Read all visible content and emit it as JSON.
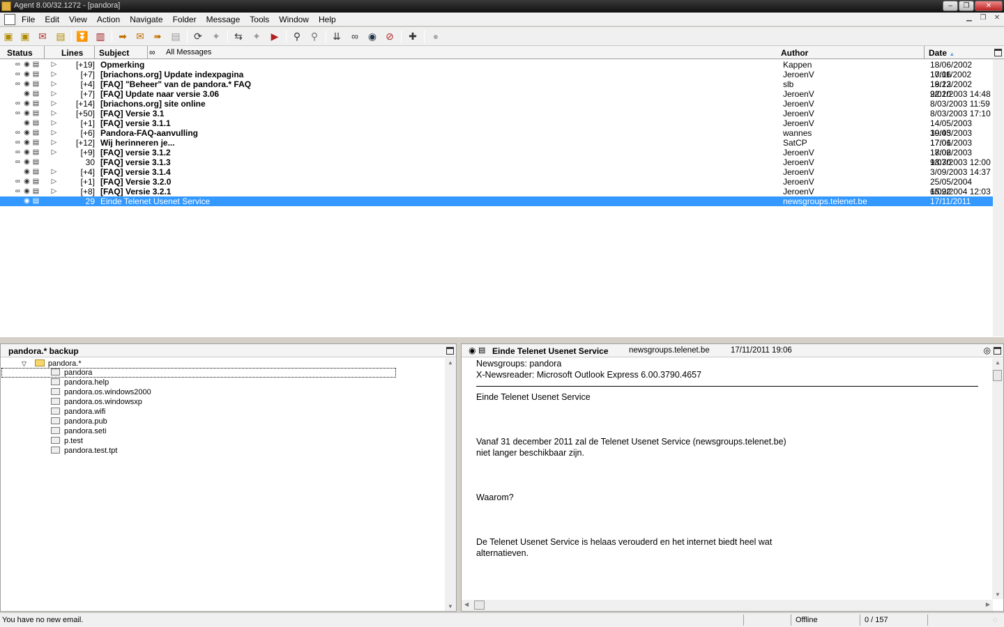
{
  "window": {
    "title": "Agent 8.00/32.1272 - [pandora]"
  },
  "menu": [
    "File",
    "Edit",
    "View",
    "Action",
    "Navigate",
    "Folder",
    "Message",
    "Tools",
    "Window",
    "Help"
  ],
  "list_header": {
    "status": "Status",
    "lines": "Lines",
    "subject": "Subject",
    "filter": "All Messages",
    "author": "Author",
    "date": "Date"
  },
  "messages": [
    {
      "lines": "[+19]",
      "subject": "Opmerking",
      "author": "Kappen",
      "date": "18/06/2002 10:06"
    },
    {
      "lines": "[+7]",
      "subject": "[briachons.org] Update indexpagina",
      "author": "JeroenV",
      "date": "17/11/2002 19:23"
    },
    {
      "lines": "[+4]",
      "subject": "[FAQ] \"Beheer\" van de pandora.* FAQ",
      "author": "slb",
      "date": "18/12/2002 22:10"
    },
    {
      "lines": "[+7]",
      "subject": "[FAQ] Update naar versie 3.06",
      "author": "JeroenV",
      "date": "9/02/2003 14:48"
    },
    {
      "lines": "[+14]",
      "subject": "[briachons.org] site online",
      "author": "JeroenV",
      "date": "8/03/2003 11:59"
    },
    {
      "lines": "[+50]",
      "subject": "[FAQ] Versie 3.1",
      "author": "JeroenV",
      "date": "8/03/2003 17:10"
    },
    {
      "lines": "[+1]",
      "subject": "[FAQ] versie 3.1.1",
      "author": "JeroenV",
      "date": "14/05/2003 19:43"
    },
    {
      "lines": "[+6]",
      "subject": "Pandora-FAQ-aanvulling",
      "author": "wannes",
      "date": "30/05/2003 17:01"
    },
    {
      "lines": "[+12]",
      "subject": "Wij herinneren je...",
      "author": "SatCP",
      "date": "17/06/2003 17:02"
    },
    {
      "lines": "[+9]",
      "subject": "[FAQ] versie 3.1.2",
      "author": "JeroenV",
      "date": "18/06/2003 13:30"
    },
    {
      "lines": "30",
      "subject": "[FAQ] versie 3.1.3",
      "author": "JeroenV",
      "date": "9/07/2003 12:00"
    },
    {
      "lines": "[+4]",
      "subject": "[FAQ] versie 3.1.4",
      "author": "JeroenV",
      "date": "3/09/2003 14:37"
    },
    {
      "lines": "[+1]",
      "subject": "[FAQ] Versie 3.2.0",
      "author": "JeroenV",
      "date": "25/05/2004 15:22"
    },
    {
      "lines": "[+8]",
      "subject": "[FAQ] Versie 3.2.1",
      "author": "JeroenV",
      "date": "6/09/2004 12:03"
    },
    {
      "lines": "29",
      "subject": "Einde Telenet Usenet Service",
      "author": "newsgroups.telenet.be",
      "date": "17/11/2011 19:06"
    }
  ],
  "folder_pane": {
    "title": "pandora.* backup",
    "root": "pandora.*",
    "groups": [
      "pandora",
      "pandora.help",
      "pandora.os.windows2000",
      "pandora.os.windowsxp",
      "pandora.wifi",
      "pandora.pub",
      "pandora.seti",
      "p.test",
      "pandora.test.tpt"
    ]
  },
  "message_pane": {
    "subject": "Einde Telenet Usenet Service",
    "from": "newsgroups.telenet.be",
    "date": "17/11/2011 19:06",
    "headers": [
      "Newsgroups: pandora",
      "X-Newsreader: Microsoft Outlook Express 6.00.3790.4657"
    ],
    "body": [
      "Einde Telenet Usenet Service",
      "Vanaf 31 december 2011 zal de Telenet Usenet Service (newsgroups.telenet.be)",
      "niet langer beschikbaar zijn.",
      "Waarom?",
      "De Telenet Usenet Service is helaas verouderd en het internet biedt heel wat",
      "alternatieven."
    ]
  },
  "statusbar": {
    "mail": "You have no new email.",
    "connection": "Offline",
    "count": "0 / 157"
  },
  "colors": {
    "selection": "#3399ff",
    "chrome": "#f0f0f0"
  }
}
